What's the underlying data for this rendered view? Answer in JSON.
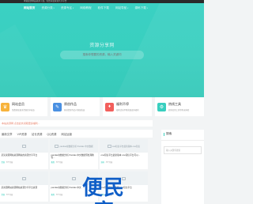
{
  "topbar": {
    "text": "本站提供精品资源下载，免费海量资源共享平台"
  },
  "nav": {
    "items": [
      {
        "label": "网站首页",
        "active": true,
        "caret": false
      },
      {
        "label": "资源分类",
        "active": false,
        "caret": true
      },
      {
        "label": "资源专区",
        "active": false,
        "caret": true
      },
      {
        "label": "网络教程",
        "active": false,
        "caret": false
      },
      {
        "label": "软件下载",
        "active": false,
        "caret": false
      },
      {
        "label": "网站导航",
        "active": false,
        "caret": true
      },
      {
        "label": "源码下载",
        "active": false,
        "caret": true
      }
    ]
  },
  "hero": {
    "title": "资源分享网",
    "search_placeholder": "搜索你想要的资源，输入关键词"
  },
  "features": [
    {
      "title": "网站会员",
      "desc": "免费获取更多资源优享权益",
      "icon": "crown-icon",
      "color": "#f7b33c"
    },
    {
      "title": "原创作品",
      "desc": "原创资源作品可获取收益",
      "icon": "pencil-icon",
      "color": "#4a90e2"
    },
    {
      "title": "福利不停",
      "desc": "福利活动不断获取更多福利",
      "icon": "gift-icon",
      "color": "#f25f5c"
    },
    {
      "title": "热线工具",
      "desc": "超多实用工具等你来体验",
      "icon": "tool-icon",
      "color": "#39cfbf"
    }
  ],
  "notice": {
    "text": "本站资源网 点击此处领取更多福利..."
  },
  "tabs": [
    "最新文章",
    "VIP资源",
    "站长资源",
    "QQ资源",
    "网站运营"
  ],
  "cards": [
    {
      "thumb": "",
      "title": "某某资源网站资源网站的资源分享平台",
      "tag": "资源",
      "meta": "5个月前"
    },
    {
      "thumb": "pandas在数据分析 Pandas 中文数据",
      "title": "pandas在数据分析 Pandas 中文数据预处理教程...",
      "tag": "教程",
      "meta": "5个月前"
    },
    {
      "thumb": "one短信平台最新版本 one短信",
      "title": "one短信平台最新版本 one短信平台可以...",
      "tag": "源码",
      "meta": "5个月前"
    },
    {
      "thumb": "",
      "title": "某资源网站资源网站资源分享平台资源",
      "tag": "资源",
      "meta": "5个月前"
    },
    {
      "thumb": "",
      "title": "pandas在数据分析 Pandas 中文",
      "tag": "教程",
      "meta": "5个月前"
    },
    {
      "thumb": "",
      "title": "one短信平台最新版 one短信平台",
      "tag": "源码",
      "meta": "5个月前"
    }
  ],
  "sidebar": {
    "heading": "搜索",
    "search_placeholder": "输入关键词搜索"
  },
  "watermark": {
    "text": "便民库"
  },
  "colors": {
    "accent": "#39cfbf",
    "notice": "#e8826b",
    "watermark": "#0f5ec7"
  }
}
